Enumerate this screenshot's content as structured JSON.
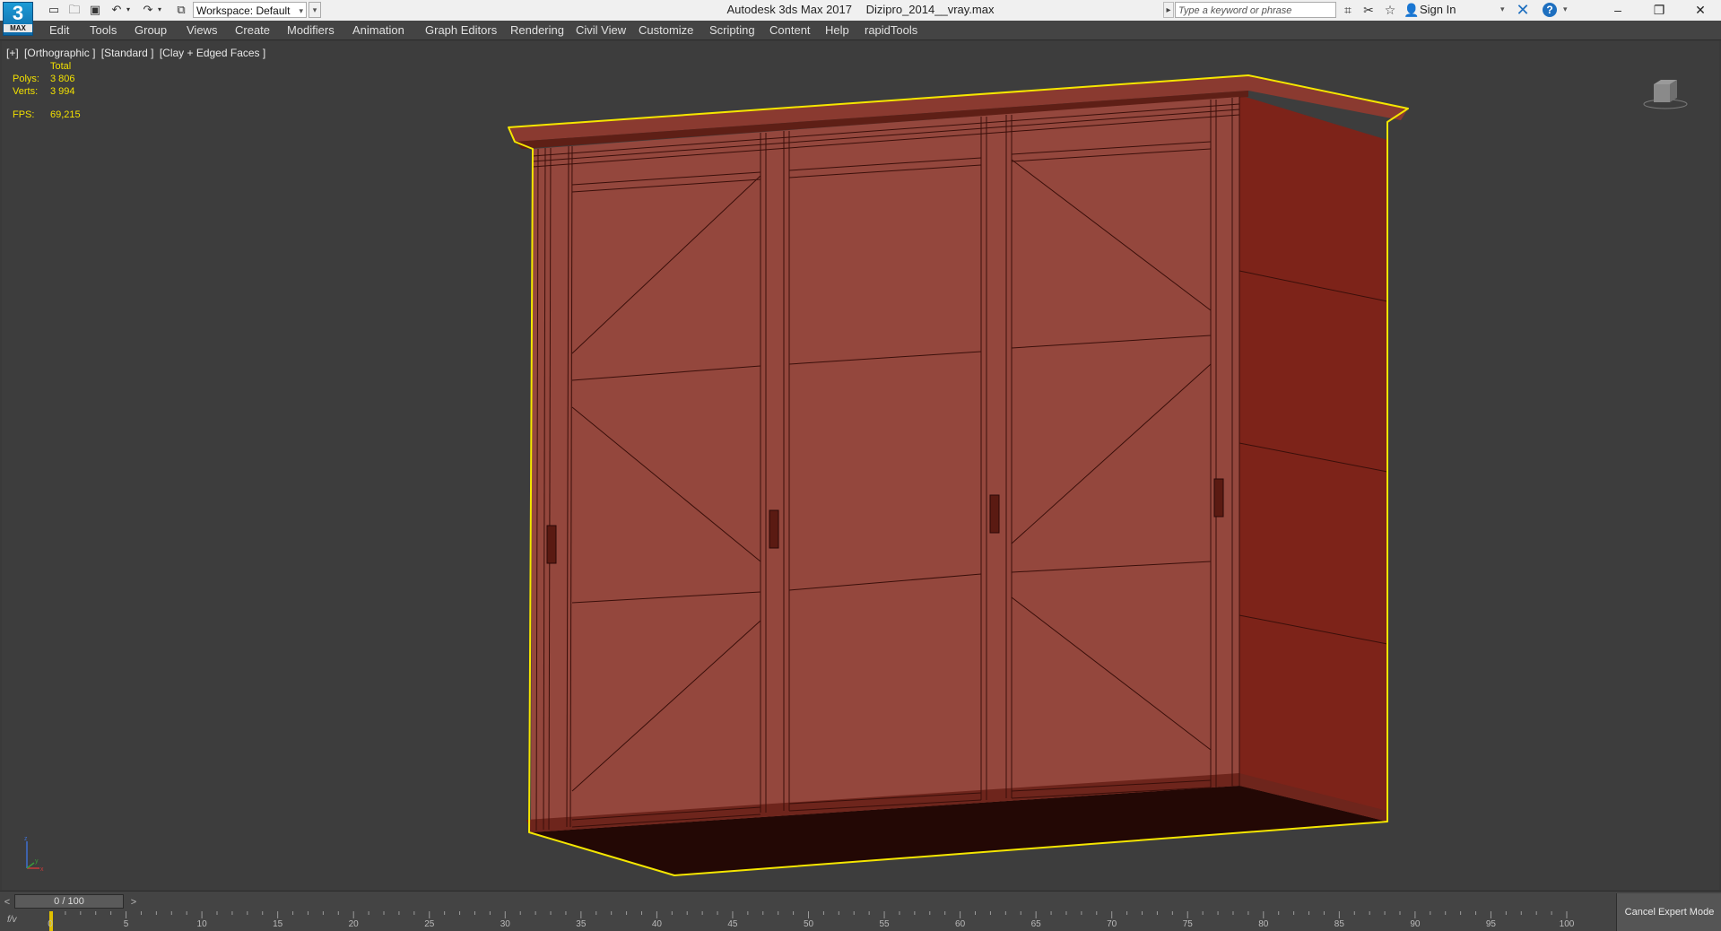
{
  "app": {
    "logo_number": "3",
    "logo_caption": "MAX",
    "title": "Autodesk 3ds Max 2017",
    "filename": "Dizipro_2014__vray.max"
  },
  "quick_access": {
    "icons": [
      "new-file-icon",
      "open-file-icon",
      "save-icon",
      "undo-icon",
      "redo-icon",
      "project-folder-icon"
    ],
    "workspace_label": "Workspace: Default"
  },
  "infocenter": {
    "search_placeholder": "Type a keyword or phrase",
    "sign_in": "Sign In",
    "icons": [
      "binoculars-icon",
      "satellite-icon",
      "star-icon",
      "user-icon",
      "exchange-icon",
      "help-icon"
    ]
  },
  "window_controls": {
    "minimize": "–",
    "restore": "❐",
    "close": "✕"
  },
  "menu": {
    "items": [
      "Edit",
      "Tools",
      "Group",
      "Views",
      "Create",
      "Modifiers",
      "Animation",
      "Graph Editors",
      "Rendering",
      "Civil View",
      "Customize",
      "Scripting",
      "Content",
      "Help",
      "rapidTools"
    ]
  },
  "viewport": {
    "label_parts": [
      "[+]",
      "[Orthographic ]",
      "[Standard ]",
      "[Clay + Edged Faces ]"
    ],
    "stats": {
      "header": "Total",
      "polys_label": "Polys:",
      "polys_value": "3 806",
      "verts_label": "Verts:",
      "verts_value": "3 994",
      "fps_label": "FPS:",
      "fps_value": "69,215"
    },
    "colors": {
      "background": "#3d3d3d",
      "clay_front": "#94473d",
      "clay_side": "#7d2319",
      "clay_shadow": "#230805",
      "selection_outline": "#f5e600",
      "stats_text": "#f2e000"
    },
    "axis_labels": [
      "x",
      "y",
      "z"
    ]
  },
  "timeline": {
    "frame_indicator": "0 / 100",
    "ticks": [
      "0",
      "5",
      "10",
      "15",
      "20",
      "25",
      "30",
      "35",
      "40",
      "45",
      "50",
      "55",
      "60",
      "65",
      "70",
      "75",
      "80",
      "85",
      "90",
      "95",
      "100"
    ],
    "expert_mode_button": "Cancel Expert Mode",
    "track_icon": "f/v"
  }
}
